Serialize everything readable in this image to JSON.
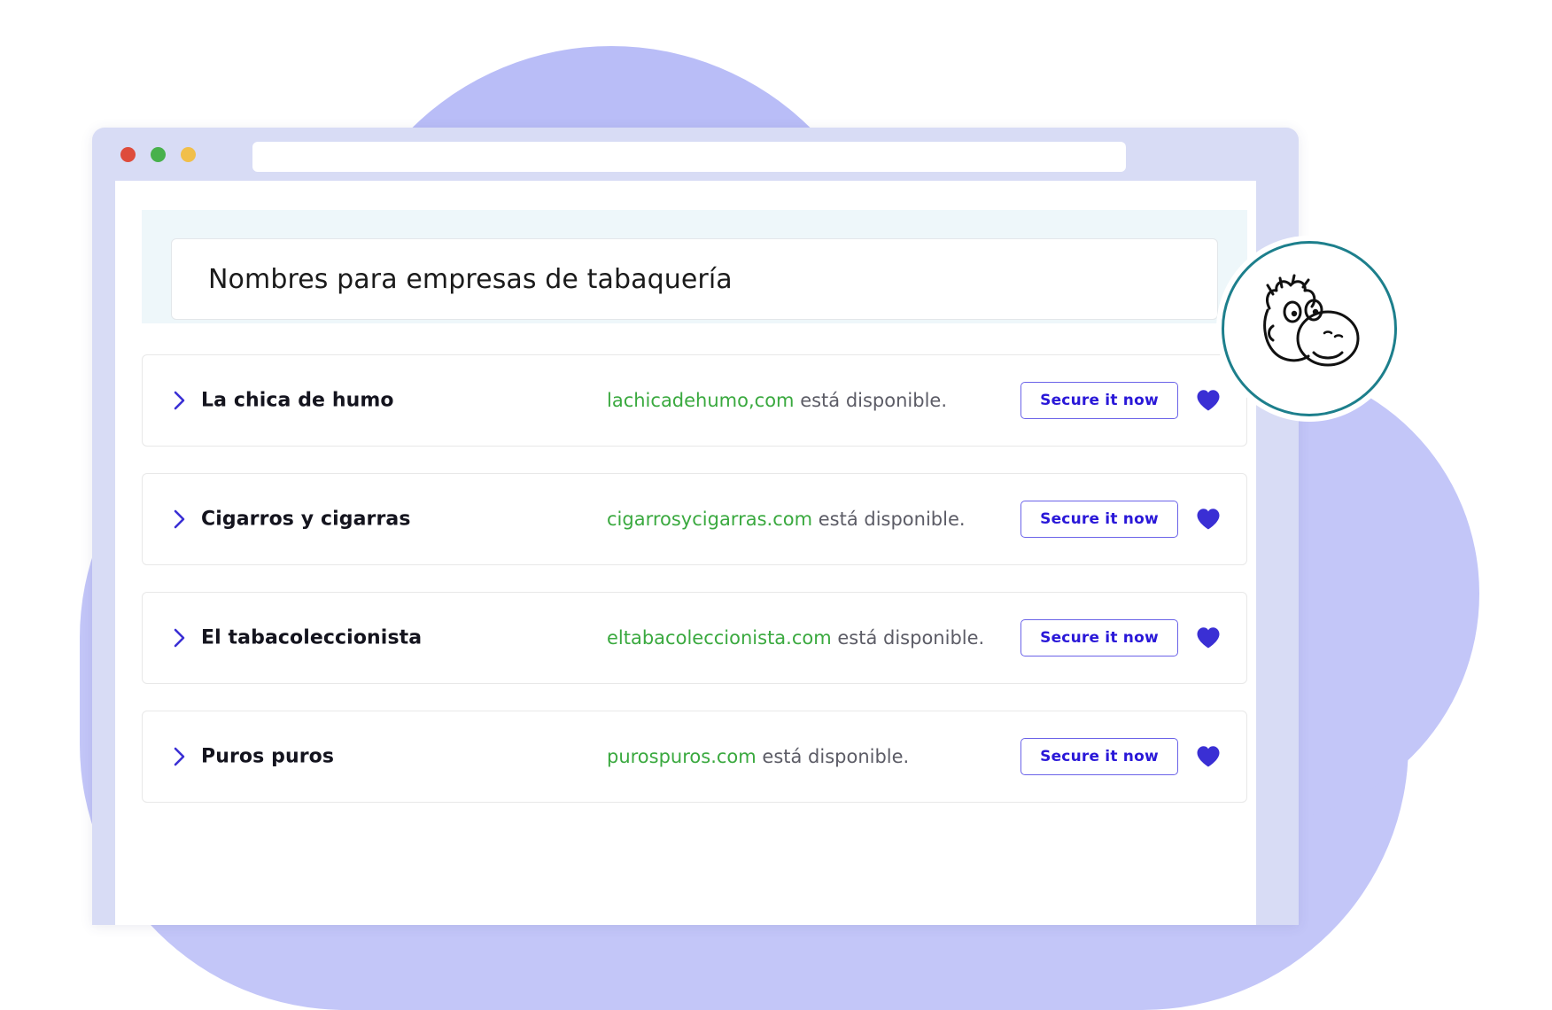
{
  "browser": {
    "window_controls": [
      {
        "name": "close",
        "color": "#de4c3c"
      },
      {
        "name": "minimize",
        "color": "#48b14c"
      },
      {
        "name": "maximize",
        "color": "#f1bf4a"
      }
    ],
    "address_bar_value": "",
    "address_bar_placeholder": ""
  },
  "search": {
    "query": "Nombres para empresas de tabaquería",
    "placeholder": "Nombres para empresas de tabaquería"
  },
  "colors": {
    "accent_purple": "#2a18d8",
    "button_border": "#6b63e8",
    "available_green": "#3aa93f",
    "chevron_blue": "#3a2fd4",
    "heart_purple": "#3a2fd4",
    "band_background": "#eef7fa",
    "window_chrome": "#d8dcf5",
    "blob_lavender": "#c3c6f8",
    "mascot_ring": "#1d7f8c"
  },
  "results": [
    {
      "name": "La chica de humo",
      "domain": "lachicadehumo,com",
      "availability": " está disponible.",
      "secure_label": "Secure it now",
      "chevron_icon": "chevron-right-icon",
      "favorite_icon": "heart-filled-icon"
    },
    {
      "name": "Cigarros y cigarras",
      "domain": "cigarrosycigarras.com",
      "availability": " está disponible.",
      "secure_label": "Secure it now",
      "chevron_icon": "chevron-right-icon",
      "favorite_icon": "heart-filled-icon"
    },
    {
      "name": "El tabacoleccionista",
      "domain": "eltabacoleccionista.com",
      "availability": " está disponible.",
      "secure_label": "Secure it now",
      "chevron_icon": "chevron-right-icon",
      "favorite_icon": "heart-filled-icon"
    },
    {
      "name": "Puros puros",
      "domain": "purospuros.com",
      "availability": " está disponible.",
      "secure_label": "Secure it now",
      "chevron_icon": "chevron-right-icon",
      "favorite_icon": "heart-filled-icon"
    }
  ],
  "mascot": {
    "icon": "mascot-face-icon",
    "alt": "cartoon mascot face"
  }
}
